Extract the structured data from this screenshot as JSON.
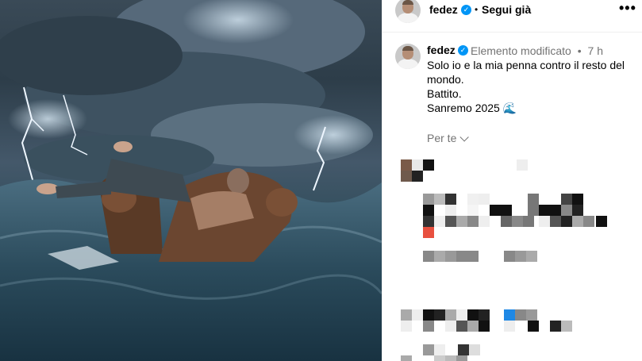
{
  "post": {
    "username": "fedez",
    "verified": true,
    "follow_status": "Segui già",
    "separator": "•",
    "more_icon": "more-horizontal-icon",
    "more_glyph": "•••"
  },
  "caption": {
    "username": "fedez",
    "edited_label": "Elemento modificato",
    "separator": "•",
    "time_ago": "7 h",
    "lines": [
      "Solo io e la mia penna contro il resto del",
      "mondo.",
      "Battito.",
      "Sanremo 2025"
    ],
    "emoji": "🌊",
    "translate_label": "Per te"
  },
  "colors": {
    "verified_blue": "#0095f6",
    "secondary_text": "#737373",
    "divider": "#efefef"
  }
}
